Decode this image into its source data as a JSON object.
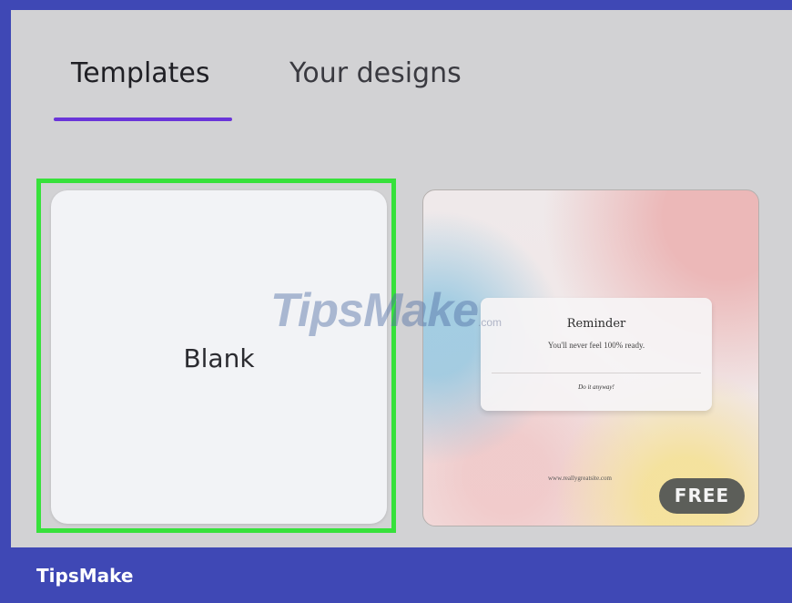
{
  "tabs": [
    {
      "label": "Templates",
      "active": true
    },
    {
      "label": "Your designs",
      "active": false
    }
  ],
  "blank_card": {
    "label": "Blank"
  },
  "template_card": {
    "reminder_title": "Reminder",
    "reminder_text": "You'll never feel 100% ready.",
    "reminder_action": "Do it anyway!",
    "url": "www.reallygreatsite.com",
    "badge": "FREE"
  },
  "watermark": {
    "text": "TipsMake",
    "suffix": ".com"
  },
  "footer": {
    "brand": "TipsMake"
  },
  "colors": {
    "frame": "#3f48b5",
    "screen_bg": "#d2d2d4",
    "tab_underline": "#6a35d9",
    "highlight": "#37e13b",
    "badge_bg": "#5c5e59"
  },
  "icons": []
}
